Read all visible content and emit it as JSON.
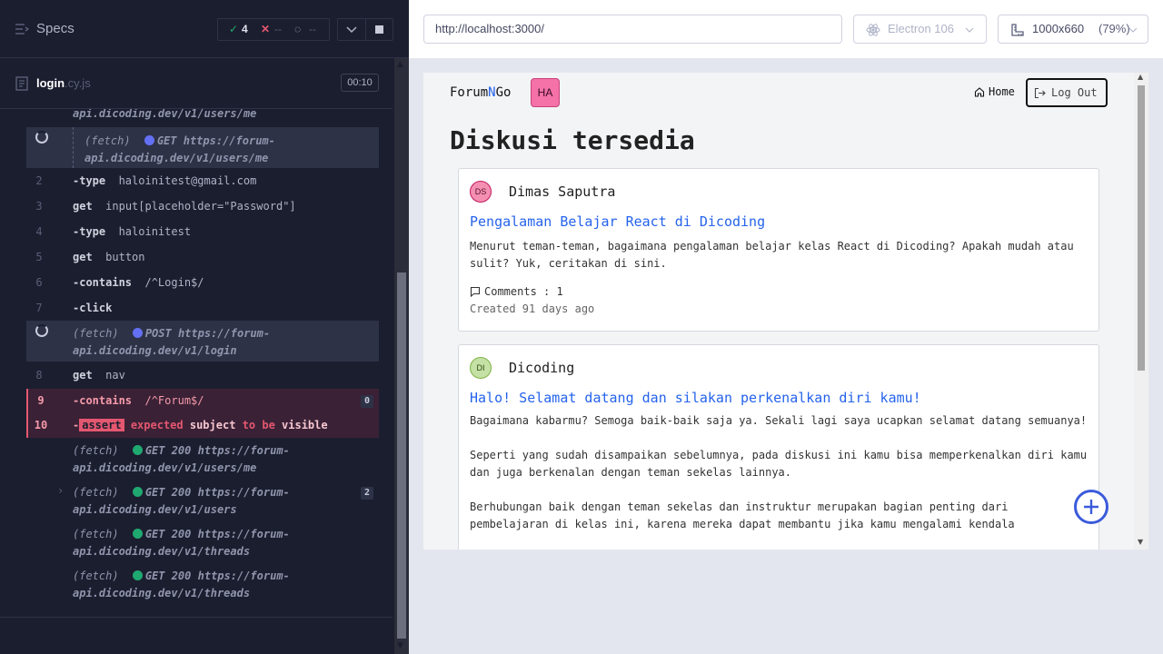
{
  "reporter": {
    "specs_label": "Specs",
    "stats": {
      "passed": "4",
      "failed": "--",
      "pending": "--"
    },
    "file": {
      "name": "login",
      "ext": ".cy.js",
      "duration": "00:10"
    },
    "commands": [
      {
        "id": "c0",
        "num": "",
        "name": "",
        "msg": "api.dicoding.dev/v1/users/me"
      },
      {
        "id": "c1",
        "line1": "(fetch)",
        "method": "GET",
        "url1": "https://forum-",
        "url2": "api.dicoding.dev/v1/users/me"
      },
      {
        "id": "c2",
        "num": "2",
        "name": "-type",
        "msg": "haloinitest@gmail.com"
      },
      {
        "id": "c3",
        "num": "3",
        "name": "get",
        "msg": "input[placeholder=\"Password\"]"
      },
      {
        "id": "c4",
        "num": "4",
        "name": "-type",
        "msg": "haloinitest"
      },
      {
        "id": "c5",
        "num": "5",
        "name": "get",
        "msg": "button"
      },
      {
        "id": "c6",
        "num": "6",
        "name": "-contains",
        "msg": "/^Login$/"
      },
      {
        "id": "c7",
        "num": "7",
        "name": "-click",
        "msg": ""
      },
      {
        "id": "c8",
        "line1": "(fetch)",
        "method": "POST",
        "url1": "https://forum-",
        "url2": "api.dicoding.dev/v1/login"
      },
      {
        "id": "c9",
        "num": "8",
        "name": "get",
        "msg": "nav"
      },
      {
        "id": "c10",
        "num": "9",
        "name": "-contains",
        "msg": "/^Forum$/",
        "badge": "0"
      },
      {
        "id": "c11",
        "num": "10",
        "name": "-",
        "tag": "assert",
        "msg_a": "expected",
        "msg_b": "subject",
        "msg_c": "to be",
        "msg_d": "visible"
      },
      {
        "id": "c12",
        "line1": "(fetch)",
        "method": "GET 200",
        "url1": "https://forum-",
        "url2": "api.dicoding.dev/v1/users/me"
      },
      {
        "id": "c13",
        "line1": "(fetch)",
        "method": "GET 200",
        "url1": "https://forum-",
        "url2": "api.dicoding.dev/v1/users",
        "badge": "2"
      },
      {
        "id": "c14",
        "line1": "(fetch)",
        "method": "GET 200",
        "url1": "https://forum-",
        "url2": "api.dicoding.dev/v1/threads"
      },
      {
        "id": "c15",
        "line1": "(fetch)",
        "method": "GET 200",
        "url1": "https://forum-",
        "url2": "api.dicoding.dev/v1/threads"
      }
    ]
  },
  "aut": {
    "url": "http://localhost:3000/",
    "browser": "Electron 106",
    "viewport": "1000x660",
    "zoom": "(79%)",
    "app": {
      "brand_a": "Forum",
      "brand_n": "N",
      "brand_b": "Go",
      "user_initials": "HA",
      "nav_home": "Home",
      "logout": "Log Out",
      "page_title": "Diskusi tersedia",
      "threads": [
        {
          "initials": "DS",
          "owner": "Dimas Saputra",
          "title": "Pengalaman Belajar React di Dicoding",
          "body": "Menurut teman-teman, bagaimana pengalaman belajar kelas React di Dicoding? Apakah mudah atau sulit? Yuk, ceritakan di sini.",
          "comments": "Comments : 1",
          "created": "Created 91 days ago"
        },
        {
          "initials": "DI",
          "owner": "Dicoding",
          "title": "Halo! Selamat datang dan silakan perkenalkan diri kamu!",
          "body_p1": "Bagaimana kabarmu? Semoga baik-baik saja ya. Sekali lagi saya ucapkan selamat datang semuanya!",
          "body_p2": "Seperti yang sudah disampaikan sebelumnya, pada diskusi ini kamu bisa memperkenalkan diri kamu dan juga berkenalan dengan teman sekelas lainnya.",
          "body_p3": "Berhubungan baik dengan teman sekelas dan instruktur merupakan bagian penting dari pembelajaran di kelas ini, karena mereka dapat membantu jika kamu mengalami kendala"
        }
      ]
    }
  },
  "colors": {
    "reporter_bg": "#1b1e2e",
    "pass": "#1fa971",
    "fail": "#e45770",
    "link": "#2563eb",
    "fab": "#3b5bdb"
  }
}
